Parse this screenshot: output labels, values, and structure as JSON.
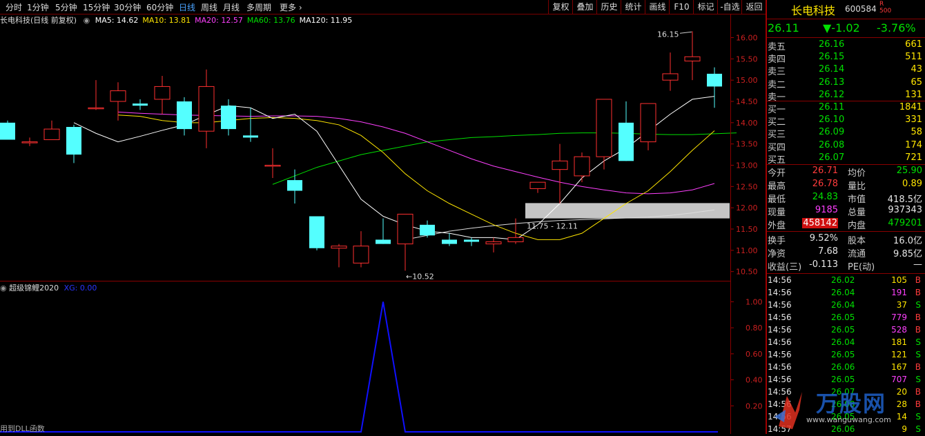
{
  "toolbar": {
    "periods": [
      "分时",
      "1分钟",
      "5分钟",
      "15分钟",
      "30分钟",
      "60分钟",
      "日线",
      "周线",
      "月线",
      "多周期",
      "更多"
    ],
    "active_period": "日线",
    "buttons": [
      "复权",
      "叠加",
      "历史",
      "统计",
      "画线",
      "F10",
      "标记",
      "-自选",
      "返回"
    ]
  },
  "main": {
    "title": "长电科技(日线 前复权)",
    "ma": [
      {
        "label": "MA5: 14.62",
        "color": "#ffffff"
      },
      {
        "label": "MA10: 13.81",
        "color": "#ffe600"
      },
      {
        "label": "MA20: 12.57",
        "color": "#ff40ff"
      },
      {
        "label": "MA60: 13.76",
        "color": "#00e000"
      },
      {
        "label": "MA120: 11.95",
        "color": "#ffffff"
      }
    ],
    "high_marker": "16.15",
    "low_marker": "10.52",
    "zone_label": "11.75 - 12.11"
  },
  "indicator": {
    "title": "超级锦鲤2020",
    "xg_label": "XG: 0.00",
    "footer": "用到DLL函数"
  },
  "chart_data": [
    {
      "type": "candlestick",
      "title": "长电科技(日线 前复权)",
      "ylim": [
        10.3,
        16.3
      ],
      "y_ticks": [
        "16.00",
        "15.50",
        "15.00",
        "14.50",
        "14.00",
        "13.50",
        "13.00",
        "12.50",
        "12.00",
        "11.50",
        "11.00",
        "10.50"
      ],
      "candles": [
        {
          "o": 14.0,
          "h": 14.05,
          "l": 13.6,
          "c": 13.6
        },
        {
          "o": 13.55,
          "h": 13.65,
          "l": 13.45,
          "c": 13.55
        },
        {
          "o": 13.6,
          "h": 14.05,
          "l": 13.6,
          "c": 13.85
        },
        {
          "o": 13.9,
          "h": 13.95,
          "l": 13.05,
          "c": 13.25
        },
        {
          "o": 14.35,
          "h": 15.0,
          "l": 14.3,
          "c": 14.35
        },
        {
          "o": 14.5,
          "h": 14.95,
          "l": 14.05,
          "c": 14.75
        },
        {
          "o": 14.45,
          "h": 14.55,
          "l": 14.3,
          "c": 14.4
        },
        {
          "o": 14.55,
          "h": 15.1,
          "l": 14.2,
          "c": 14.85
        },
        {
          "o": 14.5,
          "h": 14.6,
          "l": 13.7,
          "c": 13.85
        },
        {
          "o": 13.8,
          "h": 15.25,
          "l": 13.4,
          "c": 14.85
        },
        {
          "o": 14.4,
          "h": 14.55,
          "l": 13.7,
          "c": 13.85
        },
        {
          "o": 13.7,
          "h": 14.35,
          "l": 13.55,
          "c": 13.65
        },
        {
          "o": 13.0,
          "h": 13.4,
          "l": 12.7,
          "c": 13.0
        },
        {
          "o": 12.65,
          "h": 12.9,
          "l": 12.1,
          "c": 12.4
        },
        {
          "o": 11.8,
          "h": 11.8,
          "l": 11.0,
          "c": 11.05
        },
        {
          "o": 11.05,
          "h": 11.15,
          "l": 10.6,
          "c": 11.1
        },
        {
          "o": 10.7,
          "h": 11.45,
          "l": 10.6,
          "c": 11.1
        },
        {
          "o": 11.25,
          "h": 11.75,
          "l": 11.15,
          "c": 11.15
        },
        {
          "o": 11.15,
          "h": 11.85,
          "l": 10.52,
          "c": 11.85
        },
        {
          "o": 11.6,
          "h": 11.7,
          "l": 11.3,
          "c": 11.35
        },
        {
          "o": 11.25,
          "h": 11.4,
          "l": 11.1,
          "c": 11.15
        },
        {
          "o": 11.25,
          "h": 11.3,
          "l": 11.1,
          "c": 11.2
        },
        {
          "o": 11.15,
          "h": 11.3,
          "l": 10.95,
          "c": 11.2
        },
        {
          "o": 11.2,
          "h": 11.75,
          "l": 11.15,
          "c": 11.3
        },
        {
          "o": 12.45,
          "h": 12.6,
          "l": 12.35,
          "c": 12.6
        },
        {
          "o": 12.9,
          "h": 13.5,
          "l": 12.1,
          "c": 13.1
        },
        {
          "o": 12.75,
          "h": 13.3,
          "l": 12.6,
          "c": 13.2
        },
        {
          "o": 13.2,
          "h": 14.55,
          "l": 12.9,
          "c": 14.55
        },
        {
          "o": 14.0,
          "h": 14.5,
          "l": 13.1,
          "c": 13.1
        },
        {
          "o": 13.55,
          "h": 14.45,
          "l": 13.35,
          "c": 14.45
        },
        {
          "o": 15.0,
          "h": 15.65,
          "l": 14.75,
          "c": 15.15
        },
        {
          "o": 15.45,
          "h": 16.15,
          "l": 15.0,
          "c": 15.55
        },
        {
          "o": 15.15,
          "h": 15.3,
          "l": 14.35,
          "c": 14.85
        }
      ],
      "ma5": [
        14.0,
        13.75,
        13.55,
        13.68,
        13.82,
        13.95,
        14.18,
        14.4,
        14.35,
        14.1,
        14.2,
        13.8,
        13.0,
        12.2,
        11.8,
        11.6,
        11.45,
        11.4,
        11.3,
        11.3,
        11.25,
        11.6,
        12.1,
        12.7,
        13.1,
        13.4,
        13.8,
        14.2,
        14.55,
        14.62
      ],
      "ma10": [
        14.18,
        14.15,
        14.05,
        14.0,
        14.0,
        14.05,
        14.1,
        14.12,
        14.1,
        14.05,
        13.95,
        13.7,
        13.3,
        12.8,
        12.4,
        12.1,
        11.85,
        11.6,
        11.4,
        11.25,
        11.25,
        11.4,
        11.75,
        12.1,
        12.4,
        12.85,
        13.35,
        13.81
      ],
      "ma20": [
        14.25,
        14.22,
        14.2,
        14.18,
        14.17,
        14.16,
        14.15,
        14.16,
        14.16,
        14.15,
        14.1,
        14.02,
        13.9,
        13.75,
        13.55,
        13.35,
        13.15,
        12.98,
        12.85,
        12.72,
        12.6,
        12.5,
        12.42,
        12.35,
        12.33,
        12.35,
        12.42,
        12.57
      ],
      "ma60": [
        12.55,
        12.75,
        12.95,
        13.1,
        13.25,
        13.35,
        13.45,
        13.55,
        13.6,
        13.65,
        13.67,
        13.7,
        13.72,
        13.75,
        13.76,
        13.76,
        13.75,
        13.73,
        13.72,
        13.72,
        13.74,
        13.76
      ],
      "ma120": [
        11.25,
        11.35,
        11.45,
        11.52,
        11.58,
        11.63,
        11.67,
        11.7,
        11.72,
        11.74,
        11.76,
        11.78,
        11.82,
        11.88,
        11.95
      ]
    },
    {
      "type": "line",
      "title": "超级锦鲤2020",
      "ylim": [
        0,
        1.05
      ],
      "y_ticks": [
        "1.00",
        "0.80",
        "0.60",
        "0.40",
        "0.20"
      ],
      "series": [
        {
          "name": "XG",
          "values": [
            0,
            0,
            0,
            0,
            0,
            0,
            0,
            0,
            0,
            0,
            0,
            0,
            0,
            0,
            0,
            0,
            0,
            1,
            0,
            0,
            0,
            0,
            0,
            0,
            0,
            0,
            0,
            0,
            0,
            0,
            0,
            0,
            0
          ]
        }
      ]
    }
  ],
  "quote": {
    "name": "长电科技",
    "code": "600584",
    "r_badge": "R",
    "sub_badge": "500",
    "price": "26.11",
    "change": "▼-1.02",
    "pct": "-3.76%",
    "sell": [
      {
        "label": "卖五",
        "price": "26.16",
        "vol": "661"
      },
      {
        "label": "卖四",
        "price": "26.15",
        "vol": "511"
      },
      {
        "label": "卖三",
        "price": "26.14",
        "vol": "43"
      },
      {
        "label": "卖二",
        "price": "26.13",
        "vol": "65"
      },
      {
        "label": "卖一",
        "price": "26.12",
        "vol": "131"
      }
    ],
    "buy": [
      {
        "label": "买一",
        "price": "26.11",
        "vol": "1841"
      },
      {
        "label": "买二",
        "price": "26.10",
        "vol": "331"
      },
      {
        "label": "买三",
        "price": "26.09",
        "vol": "58"
      },
      {
        "label": "买四",
        "price": "26.08",
        "vol": "174"
      },
      {
        "label": "买五",
        "price": "26.07",
        "vol": "721"
      }
    ],
    "stats": [
      {
        "l1": "今开",
        "v1": "26.71",
        "c1": "up",
        "l2": "均价",
        "v2": "25.90",
        "c2": "down"
      },
      {
        "l1": "最高",
        "v1": "26.78",
        "c1": "up",
        "l2": "量比",
        "v2": "0.89",
        "c2": "yel"
      },
      {
        "l1": "最低",
        "v1": "24.83",
        "c1": "down",
        "l2": "市值",
        "v2": "418.5亿",
        "c2": "white"
      },
      {
        "l1": "现量",
        "v1": "9185",
        "c1": "mag",
        "l2": "总量",
        "v2": "937343",
        "c2": "white"
      },
      {
        "l1": "外盘",
        "v1": "458142",
        "c1": "upbg",
        "l2": "内盘",
        "v2": "479201",
        "c2": "down"
      }
    ],
    "stats2": [
      {
        "l1": "换手",
        "v1": "9.52%",
        "l2": "股本",
        "v2": "16.0亿"
      },
      {
        "l1": "净资",
        "v1": "7.68",
        "l2": "流通",
        "v2": "9.85亿"
      },
      {
        "l1": "收益(三)",
        "v1": "-0.113",
        "l2": "PE(动)",
        "v2": "—"
      }
    ],
    "ticks": [
      {
        "t": "14:56",
        "p": "26.02",
        "v": "105",
        "s": "B",
        "vc": "yel"
      },
      {
        "t": "14:56",
        "p": "26.04",
        "v": "191",
        "s": "B",
        "vc": "mag"
      },
      {
        "t": "14:56",
        "p": "26.04",
        "v": "37",
        "s": "S",
        "vc": "yel"
      },
      {
        "t": "14:56",
        "p": "26.05",
        "v": "779",
        "s": "B",
        "vc": "mag"
      },
      {
        "t": "14:56",
        "p": "26.05",
        "v": "528",
        "s": "B",
        "vc": "mag"
      },
      {
        "t": "14:56",
        "p": "26.04",
        "v": "181",
        "s": "S",
        "vc": "yel"
      },
      {
        "t": "14:56",
        "p": "26.05",
        "v": "121",
        "s": "S",
        "vc": "yel"
      },
      {
        "t": "14:56",
        "p": "26.06",
        "v": "167",
        "s": "B",
        "vc": "yel"
      },
      {
        "t": "14:56",
        "p": "26.05",
        "v": "707",
        "s": "S",
        "vc": "mag"
      },
      {
        "t": "14:56",
        "p": "26.07",
        "v": "20",
        "s": "B",
        "vc": "yel"
      },
      {
        "t": "14:56",
        "p": "26.08",
        "v": "28",
        "s": "B",
        "vc": "yel"
      },
      {
        "t": "14:56",
        "p": "26.05",
        "v": "14",
        "s": "S",
        "vc": "yel"
      },
      {
        "t": "14:57",
        "p": "26.06",
        "v": "9",
        "s": "S",
        "vc": "yel"
      }
    ]
  },
  "watermark": {
    "brand": "万股网",
    "site": "www.wanguwang.com"
  }
}
